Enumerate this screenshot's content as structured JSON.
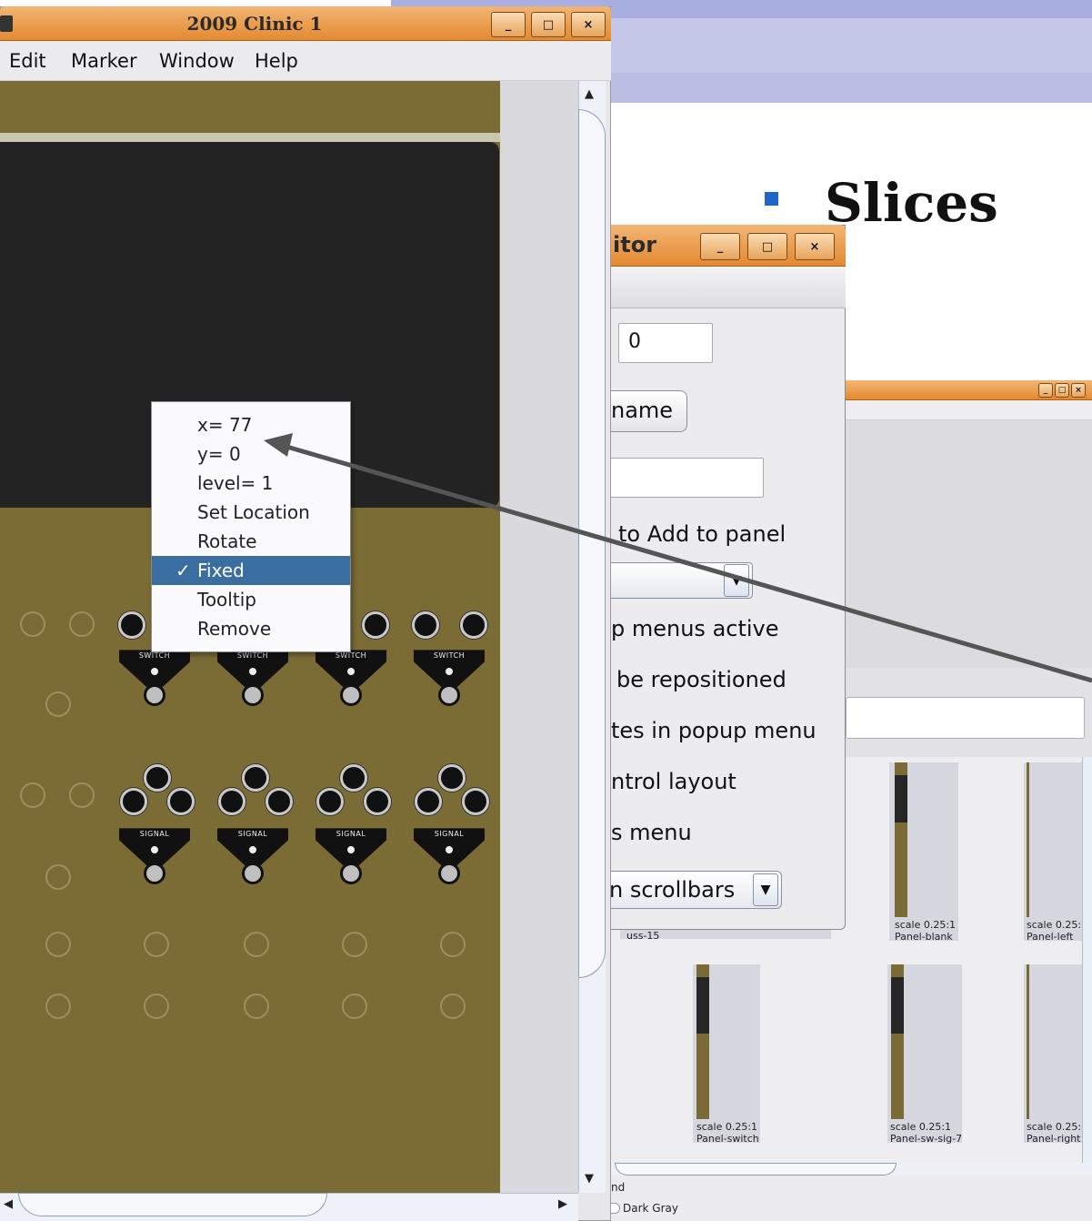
{
  "slide": {
    "title": "Slices",
    "colors": {
      "bullet": "#1f66c8",
      "band": "#c4c7e8"
    }
  },
  "main_window": {
    "title": "2009 Clinic 1",
    "menu": [
      "Edit",
      "Marker",
      "Window",
      "Help"
    ],
    "title_buttons": [
      "minimize-icon",
      "maximize-icon",
      "close-icon"
    ],
    "module_labels": {
      "switch": "SWITCH",
      "signal": "SIGNAL"
    }
  },
  "popup_menu": {
    "items": [
      {
        "label": "x= 77",
        "checked": false,
        "selected": false
      },
      {
        "label": "y= 0",
        "checked": false,
        "selected": false
      },
      {
        "label": "level= 1",
        "checked": false,
        "selected": false
      },
      {
        "label": "Set Location",
        "checked": false,
        "selected": false
      },
      {
        "label": "Rotate",
        "checked": false,
        "selected": false
      },
      {
        "label": "Fixed",
        "checked": true,
        "selected": true
      },
      {
        "label": "Tooltip",
        "checked": false,
        "selected": false
      },
      {
        "label": "Remove",
        "checked": false,
        "selected": false
      }
    ],
    "check_glyph": "✓"
  },
  "editor_window": {
    "title": "itor",
    "field_value": "0",
    "name_button": "name",
    "add_label": "to Add to panel",
    "options": [
      "p menus active",
      "be repositioned",
      "tes in popup menu",
      "ntrol layout",
      "s menu"
    ],
    "scrollbars_select": "n scrollbars"
  },
  "palette_window": {
    "tiles": [
      {
        "caption": "uss-15"
      },
      {
        "scale": "scale 0.25:1",
        "name": "Panel-blank"
      },
      {
        "scale": "scale 0.25:",
        "name": "Panel-left"
      },
      {
        "scale": "scale 0.25:1",
        "name": "Panel-switch"
      },
      {
        "scale": "scale 0.25:1",
        "name": "Panel-sw-sig-7"
      },
      {
        "scale": "scale 0.25:",
        "name": "Panel-right"
      }
    ],
    "bottom": {
      "partial_label": "nd",
      "radio_label": "Dark Gray"
    }
  },
  "colors": {
    "titlebar": "#e38a31",
    "selection": "#3a6ea1",
    "panel_face": "#7b6b35"
  }
}
